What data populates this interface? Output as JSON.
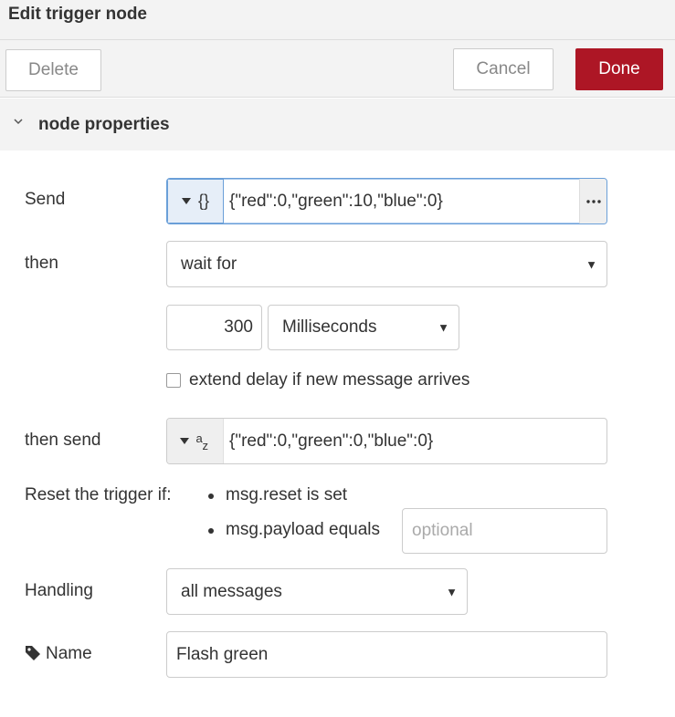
{
  "header": {
    "title": "Edit trigger node"
  },
  "toolbar": {
    "delete_label": "Delete",
    "cancel_label": "Cancel",
    "done_label": "Done"
  },
  "section": {
    "title": "node properties"
  },
  "form": {
    "send": {
      "label": "Send",
      "type_label": "{}",
      "value": "{\"red\":0,\"green\":10,\"blue\":0}"
    },
    "then": {
      "label": "then",
      "selected": "wait for"
    },
    "duration": {
      "value": "300",
      "unit": "Milliseconds"
    },
    "extend": {
      "label": "extend delay if new message arrives",
      "checked": false
    },
    "then_send": {
      "label": "then send",
      "type_label_a": "a",
      "type_label_z": "z",
      "value": "{\"red\":0,\"green\":0,\"blue\":0}"
    },
    "reset": {
      "label": "Reset the trigger if:",
      "option1": "msg.reset is set",
      "option2": "msg.payload equals",
      "payload_placeholder": "optional"
    },
    "handling": {
      "label": "Handling",
      "selected": "all messages"
    },
    "name": {
      "label": "Name",
      "value": "Flash green"
    }
  },
  "colors": {
    "done_button": "#ad1625",
    "focus_border": "#6a9fd8"
  },
  "icons": {
    "collapse": "chevron-down-icon",
    "name": "tag-icon",
    "dropdown": "caret-down-icon",
    "expand": "ellipsis-icon"
  }
}
